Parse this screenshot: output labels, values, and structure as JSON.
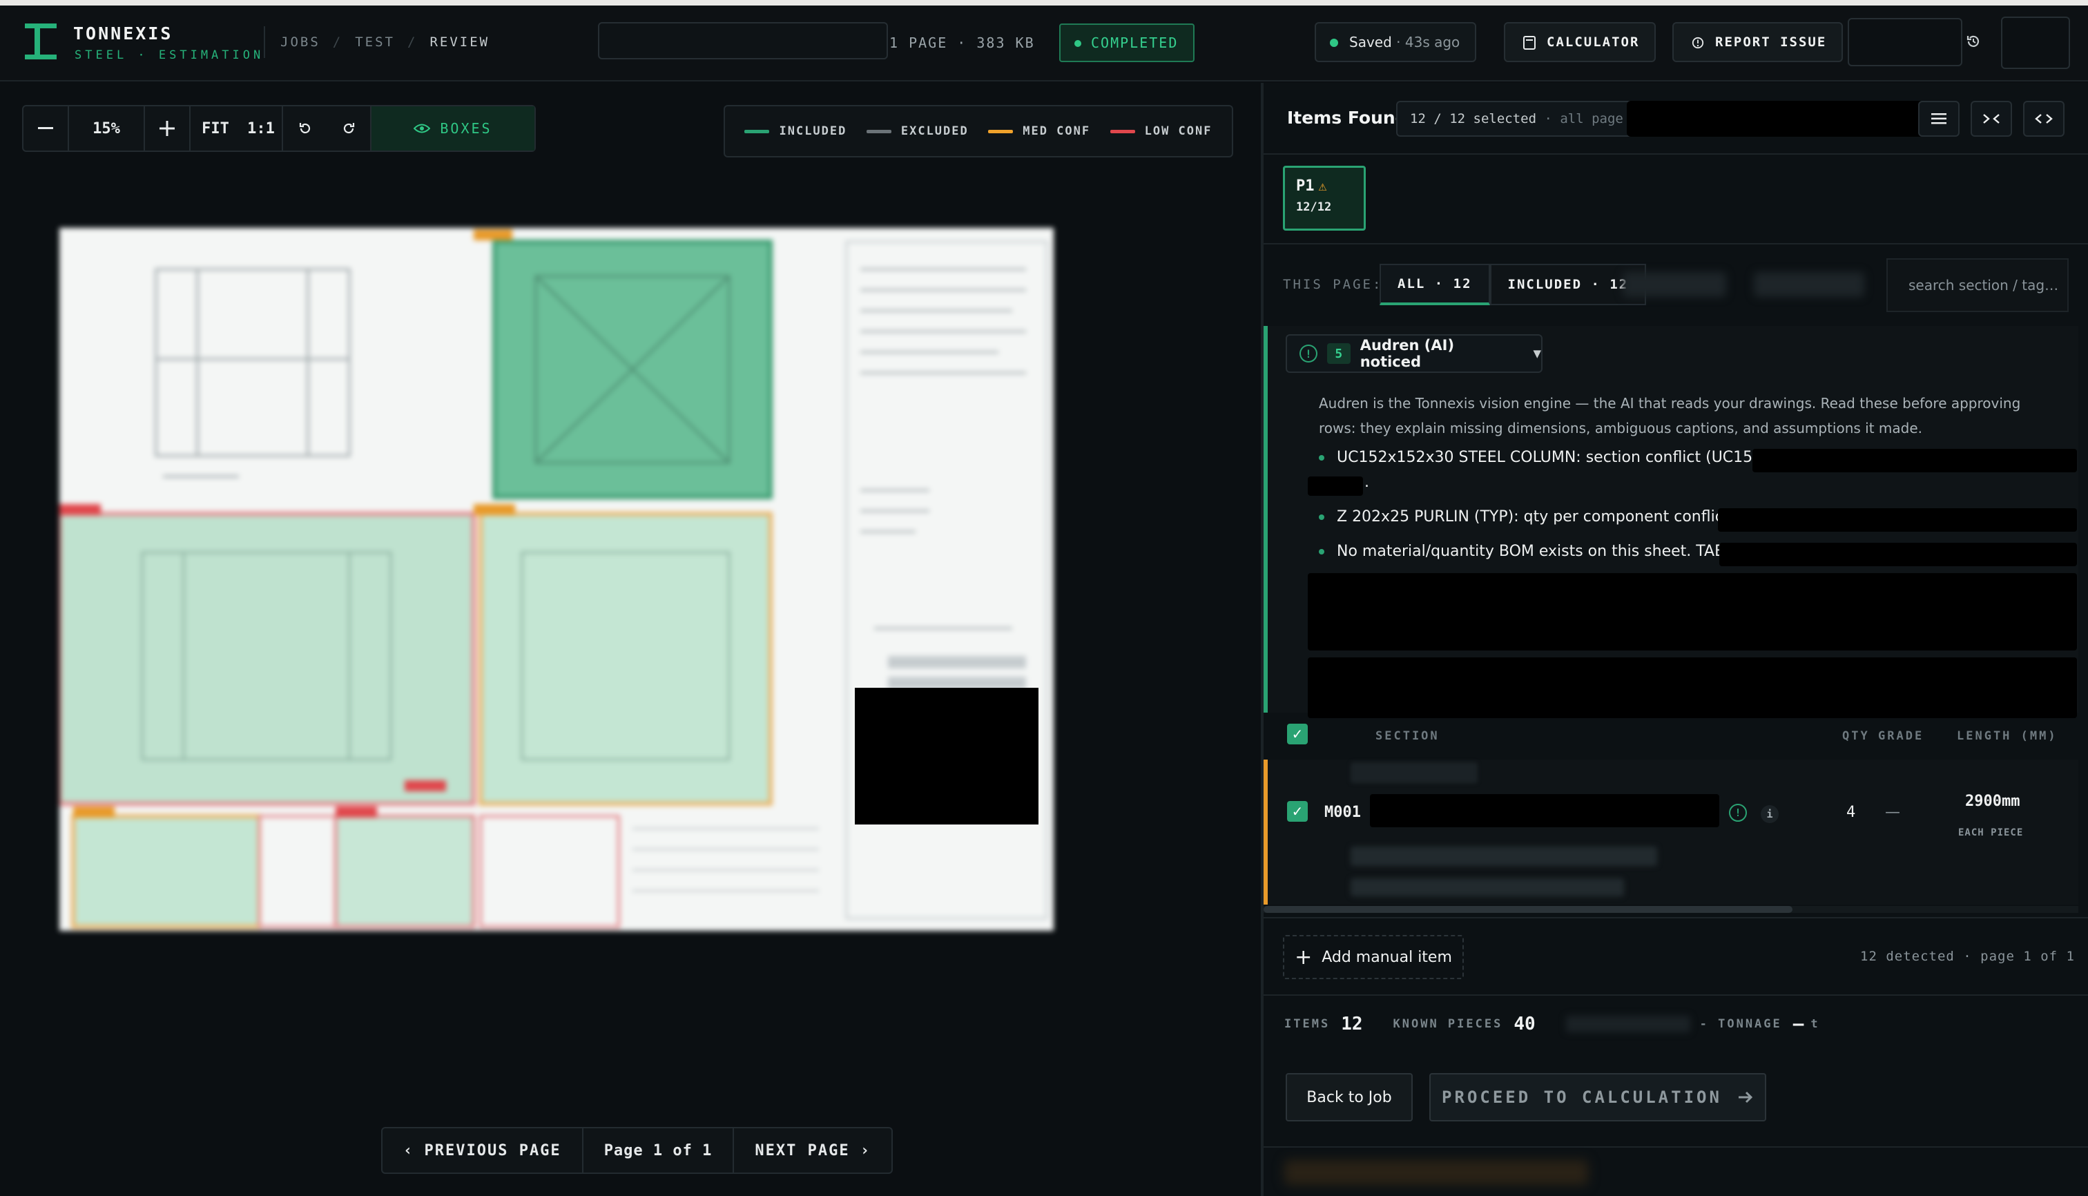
{
  "brand": {
    "name": "TONNEXIS",
    "subtitle": "STEEL · ESTIMATION"
  },
  "breadcrumb": [
    "JOBS",
    "TEST",
    "REVIEW"
  ],
  "file": {
    "meta": "1 PAGE · 383 KB",
    "status": "COMPLETED"
  },
  "save": {
    "label": "Saved",
    "ago": "43s ago"
  },
  "header_buttons": {
    "calculator": "CALCULATOR",
    "report": "REPORT ISSUE"
  },
  "viewer": {
    "zoom": "15%",
    "fit": "FIT",
    "one_to_one": "1:1",
    "boxes": "BOXES",
    "legend": [
      {
        "label": "INCLUDED",
        "color": "#2aa373"
      },
      {
        "label": "EXCLUDED",
        "color": "#6b7378"
      },
      {
        "label": "MED CONF",
        "color": "#f0a22b"
      },
      {
        "label": "LOW CONF",
        "color": "#e0474c"
      }
    ],
    "pager": {
      "prev": "‹ PREVIOUS PAGE",
      "label": "Page 1 of 1",
      "next": "NEXT PAGE ›"
    }
  },
  "panel": {
    "title": "Items Found",
    "selection": "12 / 12 selected",
    "selection_scope": "· all page",
    "page_card": {
      "label": "P1",
      "count": "12/12"
    },
    "this_page_label": "THIS PAGE:",
    "tabs": {
      "all": "ALL · 12",
      "included": "INCLUDED · 12"
    },
    "search_placeholder": "search section / tag…",
    "notice": {
      "count": "5",
      "title": "Audren (AI) noticed",
      "body": "Audren is the Tonnexis vision engine — the AI that reads your drawings. Read these before approving rows: they explain missing dimensions, ambiguous captions, and assumptions it made.",
      "items": [
        "UC152x152x30 STEEL COLUMN: section conflict (UC152x1",
        "Z 202x25 PURLIN (TYP): qty per component conflict (",
        "No material/quantity BOM exists on this sheet. TABLE"
      ],
      "trail": "."
    },
    "columns": {
      "section": "SECTION",
      "qty": "QTY",
      "grade": "GRADE",
      "length": "LENGTH (MM)"
    },
    "row": {
      "mark": "M001",
      "qty": "4",
      "grade": "—",
      "length": "2900mm",
      "length_sub": "EACH PIECE"
    },
    "add_manual": "Add manual item",
    "detected": "12 detected · page 1 of 1",
    "stats": {
      "items_label": "ITEMS",
      "items": "12",
      "pieces_label": "KNOWN PIECES",
      "pieces": "40",
      "tonnage_label": "- TONNAGE",
      "tonnage": "—",
      "tonnage_unit": "t"
    },
    "back": "Back to Job",
    "proceed": "PROCEED TO CALCULATION"
  }
}
